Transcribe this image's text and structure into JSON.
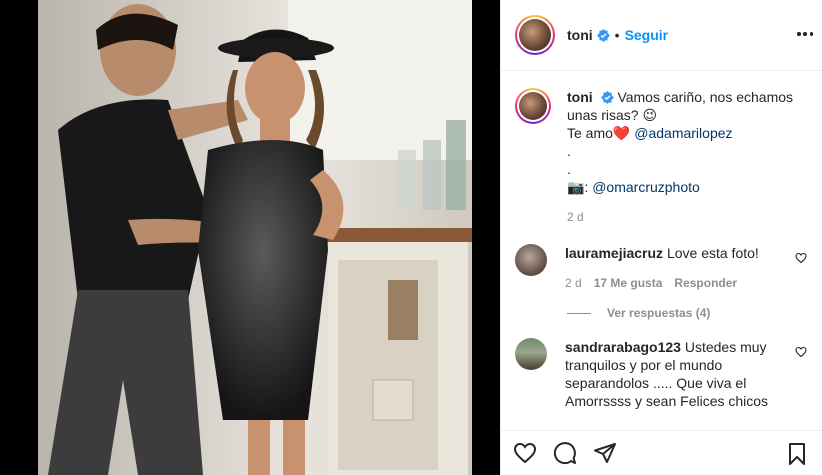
{
  "post": {
    "author": {
      "username": "toni",
      "verified": true,
      "follow_label": "Seguir",
      "separator": "•"
    },
    "caption": {
      "text": "Vamos cariño, nos echamos unas risas?",
      "emoji": "😉",
      "line2_prefix": "Te amo",
      "line2_emoji": "❤️",
      "mention": "@adamarilopez",
      "dot1": ".",
      "dot2": ".",
      "credit_prefix": "📷:",
      "credit_mention": "@omarcruzphoto",
      "time": "2 d"
    },
    "comments": [
      {
        "username": "laurامejiacruz",
        "text": "Love esta foto!",
        "time": "2 d",
        "likes": "17 Me gusta",
        "reply_label": "Responder",
        "view_replies": "Ver respuestas (4)"
      },
      {
        "username": "sandrarabago123",
        "text": "Ustedes muy tranquilos y por el mundo separandolos ..... Que viva el Amorrssss y sean Felices chicos"
      }
    ]
  },
  "colors": {
    "accent": "#0095f6",
    "verified": "#3897f0",
    "heart": "#ed4956",
    "muted": "#8e8e8e"
  },
  "icons": [
    "verified-badge-icon",
    "more-options-icon",
    "heart-icon",
    "comment-icon",
    "share-icon",
    "bookmark-icon"
  ]
}
